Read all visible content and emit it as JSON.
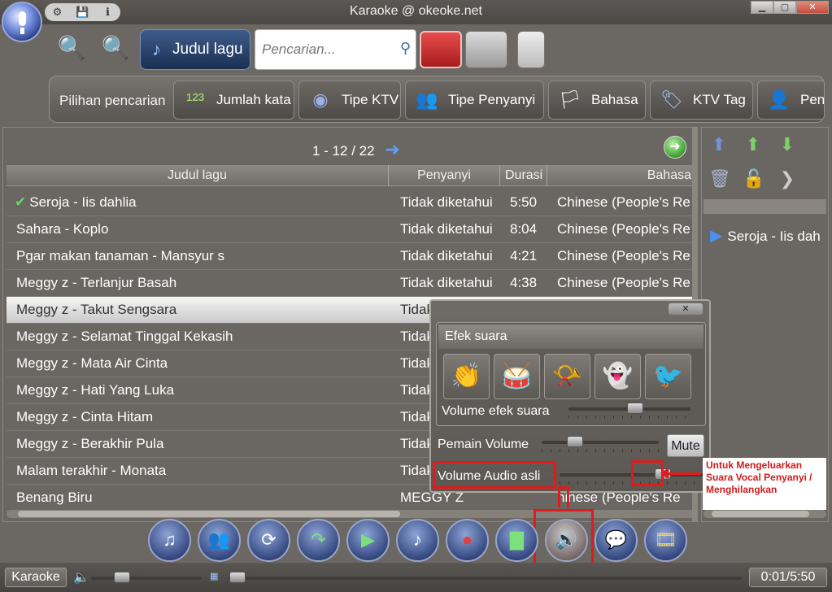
{
  "window": {
    "title": "Karaoke @ okeoke.net",
    "min": "▁",
    "max": "▢",
    "close": "✕"
  },
  "topicons": [
    "⚙",
    "💾",
    "ℹ"
  ],
  "toolbar": {
    "judul_label": "Judul lagu",
    "search_placeholder": "Pencarian..."
  },
  "filters": {
    "label": "Pilihan pencarian",
    "chips": [
      "Jumlah kata",
      "Tipe KTV",
      "Tipe Penyanyi",
      "Bahasa",
      "KTV Tag",
      "Pen"
    ]
  },
  "pager": {
    "text": "1   - 12 / 22"
  },
  "table": {
    "columns": [
      "Judul lagu",
      "Penyanyi",
      "Durasi",
      "Bahasa"
    ],
    "rows": [
      {
        "title": "Seroja - Iis dahlia",
        "singer": "Tidak diketahui",
        "dur": "5:50",
        "lang": "Chinese (People's Re",
        "checked": true
      },
      {
        "title": "Sahara - Koplo",
        "singer": "Tidak diketahui",
        "dur": "8:04",
        "lang": "Chinese (People's Re"
      },
      {
        "title": "Pgar makan tanaman - Mansyur s",
        "singer": "Tidak diketahui",
        "dur": "4:21",
        "lang": "Chinese (People's Re"
      },
      {
        "title": "Meggy z - Terlanjur Basah",
        "singer": "Tidak diketahui",
        "dur": "4:38",
        "lang": "Chinese (People's Re"
      },
      {
        "title": "Meggy z - Takut Sengsara",
        "singer": "Tidak",
        "dur": "",
        "lang": "",
        "selected": true
      },
      {
        "title": "Meggy z - Selamat Tinggal Kekasih",
        "singer": "Tidak",
        "dur": "",
        "lang": ""
      },
      {
        "title": "Meggy z - Mata Air Cinta",
        "singer": "Tidak",
        "dur": "",
        "lang": ""
      },
      {
        "title": "Meggy z - Hati Yang Luka",
        "singer": "Tidak",
        "dur": "",
        "lang": ""
      },
      {
        "title": "Meggy z - Cinta Hitam",
        "singer": "Tidak",
        "dur": "",
        "lang": ""
      },
      {
        "title": "Meggy z - Berakhir Pula",
        "singer": "Tidak",
        "dur": "",
        "lang": ""
      },
      {
        "title": "Malam terakhir - Monata",
        "singer": "Tidak",
        "dur": "",
        "lang": ""
      },
      {
        "title": "Benang Biru",
        "singer": "MEGGY Z",
        "dur": "",
        "lang": "hinese (People's Re"
      }
    ]
  },
  "playlist": {
    "item": "Seroja - Iis dah"
  },
  "popup": {
    "close": "✕",
    "efek_title": "Efek suara",
    "efek_volume_label": "Volume efek suara",
    "pemain_label": "Pemain Volume",
    "mute_label": "Mute",
    "audio_label": "Volume Audio asli",
    "efek_volume": 0.55,
    "pemain_volume": 0.25,
    "audio_volume": 0.75
  },
  "annotation": "Untuk Mengeluarkan Suara Vocal Penyanyi / Menghilangkan",
  "status": {
    "label": "Karaoke",
    "time": "0:01/5:50"
  },
  "colors": {
    "accent": "#3e5c8a",
    "highlight": "#e01b1b",
    "selected_row": "#e8e8e8"
  }
}
